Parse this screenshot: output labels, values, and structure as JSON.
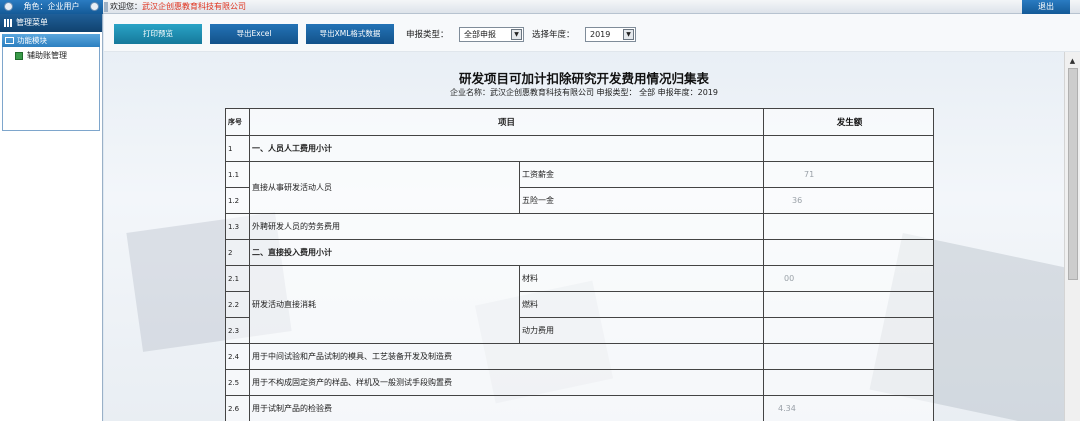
{
  "topbar": {
    "role_label": "角色：企业用户",
    "welcome_label": "欢迎您：",
    "company_name": "武汉企创惠教育科技有限公司",
    "logout_label": "退出"
  },
  "sidebar": {
    "menu_title": "管理菜单",
    "module_title": "功能模块",
    "items": [
      {
        "label": "辅助账管理"
      }
    ]
  },
  "toolbar": {
    "print_label": "打印预览",
    "export_excel_label": "导出Excel",
    "export_xml_label": "导出XML格式数据",
    "report_type_label": "申报类型：",
    "report_type_value": "全部申报",
    "year_label": "选择年度：",
    "year_value": "2019"
  },
  "report": {
    "title": "研发项目可加计扣除研究开发费用情况归集表",
    "subtitle": "企业名称：武汉企创惠教育科技有限公司 申报类型： 全部 申报年度：2019",
    "headers": {
      "seq": "序号",
      "item": "项目",
      "amount": "发生额"
    },
    "rows": [
      {
        "seq": "1",
        "item": "一、人员人工费用小计",
        "amount": ""
      },
      {
        "seq": "1.1",
        "group": "直接从事研发活动人员",
        "sub": "工资薪金",
        "amount": "71"
      },
      {
        "seq": "1.2",
        "sub": "五险一金",
        "amount": "36"
      },
      {
        "seq": "1.3",
        "item": "外聘研发人员的劳务费用",
        "amount": ""
      },
      {
        "seq": "2",
        "item": "二、直接投入费用小计",
        "amount": ""
      },
      {
        "seq": "2.1",
        "group": "研发活动直接消耗",
        "sub": "材料",
        "amount": "00"
      },
      {
        "seq": "2.2",
        "sub": "燃料",
        "amount": ""
      },
      {
        "seq": "2.3",
        "sub": "动力费用",
        "amount": ""
      },
      {
        "seq": "2.4",
        "item": "用于中间试验和产品试制的模具、工艺装备开发及制造费",
        "amount": ""
      },
      {
        "seq": "2.5",
        "item": "用于不构成固定资产的样品、样机及一般测试手段购置费",
        "amount": ""
      },
      {
        "seq": "2.6",
        "item": "用于试制产品的检验费",
        "amount": "4.34"
      }
    ]
  },
  "colors": {
    "accent": "#1b5f9e",
    "company_text": "#e0321d"
  }
}
